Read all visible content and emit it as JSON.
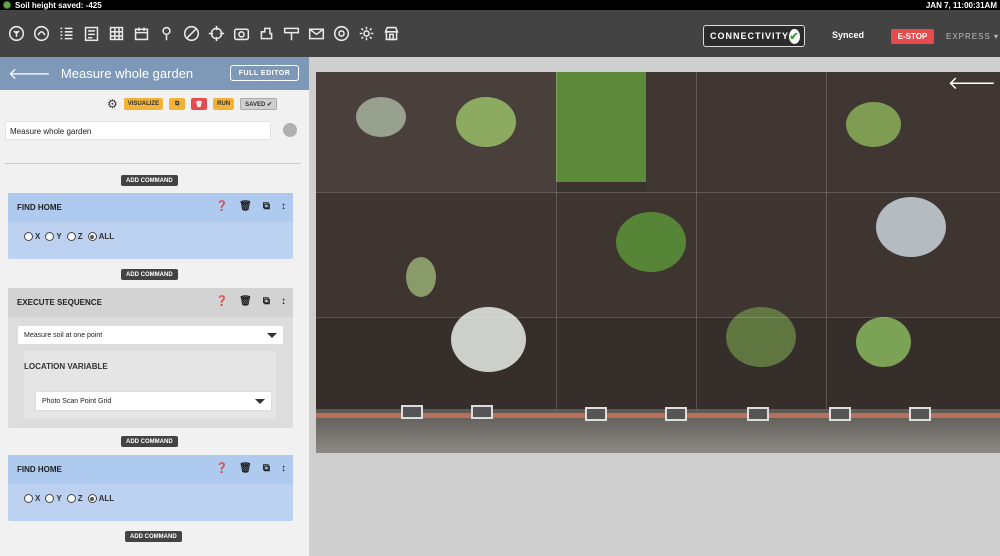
{
  "topbar": {
    "status_text": "Soil height saved: -425",
    "datetime": "JAN 7, 11:00:31AM"
  },
  "nav": {
    "icons": [
      "plants-icon",
      "farmware-icon",
      "sequences-icon",
      "regimens-icon",
      "map-grid-icon",
      "events-icon",
      "point-icon",
      "weeds-icon",
      "crosshair-icon",
      "photos-icon",
      "tools-icon",
      "controls-icon",
      "messages-icon",
      "help-icon",
      "settings-icon",
      "shop-icon"
    ],
    "connectivity_label": "CONNECTIVITY",
    "synced_label": "Synced",
    "estop_label": "E-STOP",
    "device_label": "EXPRESS ▾"
  },
  "panel": {
    "title": "Measure whole garden",
    "full_editor_label": "FULL EDITOR",
    "toolbar": {
      "visualize_label": "VISUALIZE",
      "run_label": "RUN",
      "saved_label": "SAVED ✔"
    },
    "name_value": "Measure whole garden",
    "add_command_label": "ADD COMMAND",
    "steps": [
      {
        "title": "FIND HOME",
        "axes": [
          "X",
          "Y",
          "Z",
          "ALL"
        ],
        "selected": "ALL"
      },
      {
        "title": "EXECUTE SEQUENCE",
        "sequence": "Measure soil at one point",
        "variable_label": "LOCATION VARIABLE",
        "variable_value": "Photo Scan Point Grid"
      },
      {
        "title": "FIND HOME",
        "axes": [
          "X",
          "Y",
          "Z",
          "ALL"
        ],
        "selected": "ALL"
      }
    ]
  },
  "colors": {
    "topbar_bg": "#000000",
    "navbar_bg": "#434343",
    "panel_header": "#7e98b7",
    "step_home": "#aecaef",
    "step_exec": "#d3d3d3",
    "accent_yellow": "#f3b136",
    "estop_red": "#e74c4c"
  }
}
